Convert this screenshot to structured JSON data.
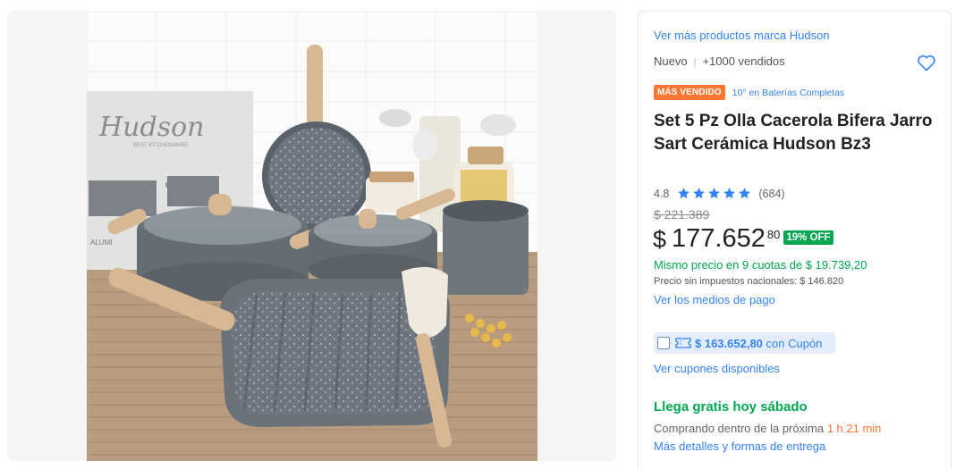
{
  "gallery": {
    "box_logo": "Hudson",
    "box_sub": "BEST KITCHENWARE",
    "box_side": "ALUMI"
  },
  "product": {
    "brand_link": "Ver más productos marca Hudson",
    "condition": "Nuevo",
    "sold": "+1000 vendidos",
    "badge_best": "MÁS VENDIDO",
    "badge_rank": "10° en Baterías Completas",
    "title": "Set 5 Pz Olla Cacerola Bifera Jarro Sart Cerámica Hudson Bz3",
    "rating_value": "4.8",
    "rating_count": "(684)",
    "old_price": "$ 221.389",
    "currency": "$",
    "price": "177.652",
    "cents": "80",
    "discount": "19% OFF",
    "installments": "Mismo precio en 9 cuotas de $ 19.739,20",
    "no_tax": "Precio sin impuestos nacionales: $ 146.820",
    "payment_link": "Ver los medios de pago",
    "coupon_amount": "$ 163.652,80",
    "coupon_label": "con Cupón",
    "coupons_link": "Ver cupones disponibles",
    "delivery": "Llega gratis hoy sábado",
    "deadline_prefix": "Comprando dentro de la próxima",
    "deadline_time": "1 h 21 min",
    "delivery_link": "Más detalles y formas de entrega"
  },
  "colors": {
    "accent_blue": "#3483fa",
    "green": "#00a650",
    "orange": "#ff7733",
    "star": "#3483fa"
  },
  "icons": [
    "heart-icon",
    "star-icon",
    "ticket-icon",
    "checkbox-icon"
  ]
}
